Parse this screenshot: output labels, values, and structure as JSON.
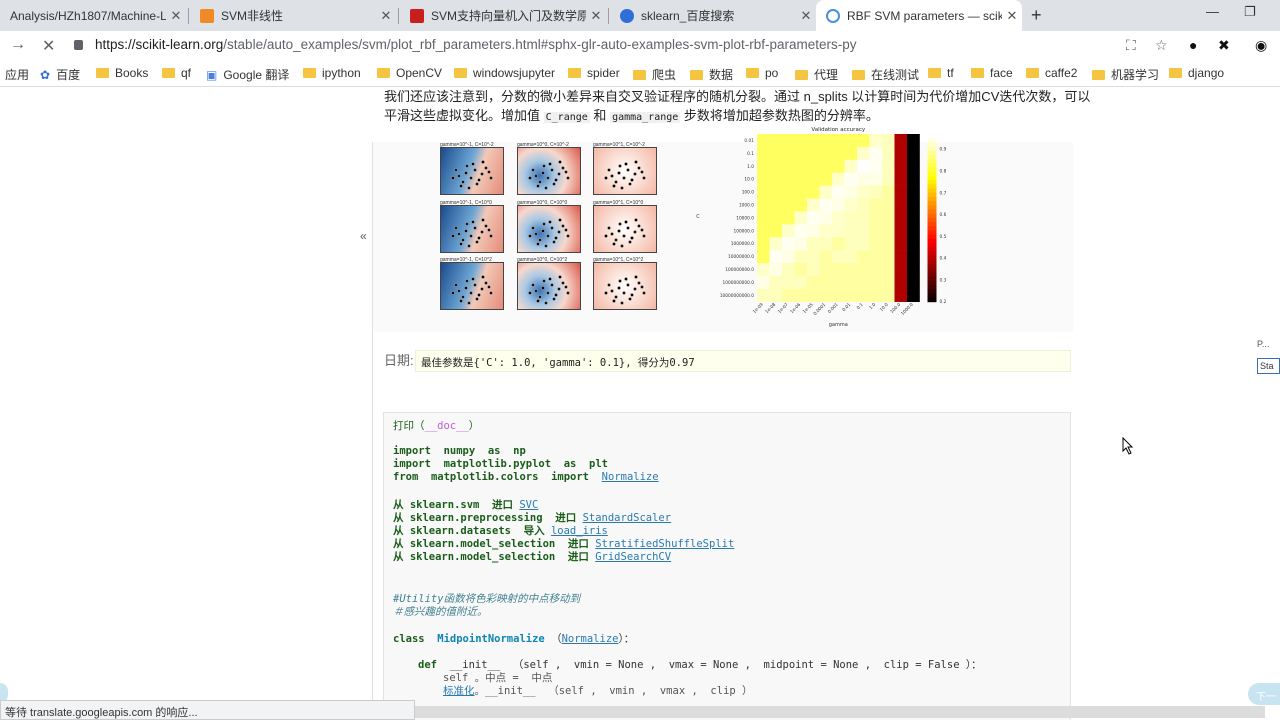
{
  "tabs": [
    {
      "title": "Analysis/HZh1807/Machine-Le",
      "favicon_color": "#24292e"
    },
    {
      "title": "SVM非线性",
      "favicon_color": "#f08a24"
    },
    {
      "title": "SVM支持向量机入门及数学原理",
      "favicon_color": "#c81e1e"
    },
    {
      "title": "sklearn_百度搜索",
      "favicon_color": "#2f6fd6"
    },
    {
      "title": "RBF SVM parameters — scikit-",
      "favicon_color": "#4a90d9"
    }
  ],
  "window_controls": {
    "minimize": "—",
    "restore": "❐"
  },
  "url": {
    "host": "https://scikit-learn.org",
    "path": "/stable/auto_examples/svm/plot_rbf_parameters.html#sphx-glr-auto-examples-svm-plot-rbf-parameters-py"
  },
  "bookmarks": {
    "apps": "应用",
    "items": [
      "百度",
      "Books",
      "qf",
      "Google 翻译",
      "ipython",
      "OpenCV",
      "windowsjupyter",
      "spider",
      "爬虫",
      "数据",
      "po",
      "代理",
      "在线测试",
      "tf",
      "face",
      "caffe2",
      "机器学习",
      "django"
    ]
  },
  "doc": {
    "para_line1": "我们还应该注意到，分数的微小差异来自交叉验证程序的随机分裂。通过 n_splits 以计算时间为代价增加CV迭代次数，可以",
    "para_line2_a": "平滑这些虚拟变化。增加值",
    "para_code1": "C_range",
    "para_line2_b": "和",
    "para_code2": "gamma_range",
    "para_line2_c": "步数将增加超参数热图的分辨率。",
    "collapse_icon": "«"
  },
  "figure": {
    "panel_titles": [
      "gamma=10^-1, C=10^-2",
      "gamma=10^0, C=10^-2",
      "gamma=10^1, C=10^-2",
      "gamma=10^-1, C=10^0",
      "gamma=10^0, C=10^0",
      "gamma=10^1, C=10^0",
      "gamma=10^-1, C=10^2",
      "gamma=10^0, C=10^2",
      "gamma=10^1, C=10^2"
    ]
  },
  "chart_data": {
    "type": "heatmap",
    "title": "Validation accuracy",
    "xlabel": "gamma",
    "ylabel": "C",
    "x_ticks": [
      "1e-09",
      "1e-08",
      "1e-07",
      "1e-06",
      "1e-05",
      "0.0001",
      "0.001",
      "0.01",
      "0.1",
      "1.0",
      "10.0",
      "100.0",
      "1000.0"
    ],
    "y_ticks": [
      "0.01",
      "0.1",
      "1.0",
      "10.0",
      "100.0",
      "1000.0",
      "10000.0",
      "100000.0",
      "1000000.0",
      "10000000.0",
      "100000000.0",
      "1000000000.0",
      "10000000000.0"
    ],
    "colorbar_ticks": [
      0.2,
      0.3,
      0.4,
      0.5,
      0.6,
      0.7,
      0.8,
      0.9
    ],
    "value_range": [
      0.2,
      0.97
    ],
    "values": [
      [
        0.85,
        0.85,
        0.85,
        0.85,
        0.85,
        0.85,
        0.85,
        0.85,
        0.85,
        0.93,
        0.92,
        0.4,
        0.2
      ],
      [
        0.85,
        0.85,
        0.85,
        0.85,
        0.85,
        0.85,
        0.85,
        0.85,
        0.93,
        0.96,
        0.92,
        0.4,
        0.2
      ],
      [
        0.85,
        0.85,
        0.85,
        0.85,
        0.85,
        0.85,
        0.85,
        0.93,
        0.97,
        0.96,
        0.92,
        0.4,
        0.2
      ],
      [
        0.85,
        0.85,
        0.85,
        0.85,
        0.85,
        0.85,
        0.93,
        0.96,
        0.95,
        0.95,
        0.92,
        0.4,
        0.2
      ],
      [
        0.85,
        0.85,
        0.85,
        0.85,
        0.85,
        0.93,
        0.96,
        0.95,
        0.93,
        0.92,
        0.9,
        0.4,
        0.2
      ],
      [
        0.85,
        0.85,
        0.85,
        0.85,
        0.93,
        0.96,
        0.95,
        0.93,
        0.92,
        0.9,
        0.9,
        0.4,
        0.2
      ],
      [
        0.85,
        0.85,
        0.85,
        0.93,
        0.96,
        0.95,
        0.93,
        0.92,
        0.92,
        0.9,
        0.9,
        0.4,
        0.2
      ],
      [
        0.85,
        0.85,
        0.93,
        0.96,
        0.95,
        0.93,
        0.93,
        0.92,
        0.92,
        0.9,
        0.9,
        0.4,
        0.2
      ],
      [
        0.85,
        0.93,
        0.96,
        0.95,
        0.92,
        0.92,
        0.9,
        0.92,
        0.92,
        0.9,
        0.9,
        0.4,
        0.2
      ],
      [
        0.85,
        0.96,
        0.95,
        0.92,
        0.92,
        0.9,
        0.92,
        0.92,
        0.9,
        0.9,
        0.9,
        0.4,
        0.2
      ],
      [
        0.93,
        0.95,
        0.92,
        0.9,
        0.92,
        0.9,
        0.9,
        0.9,
        0.9,
        0.9,
        0.9,
        0.4,
        0.2
      ],
      [
        0.95,
        0.92,
        0.92,
        0.92,
        0.9,
        0.9,
        0.9,
        0.9,
        0.9,
        0.9,
        0.9,
        0.4,
        0.2
      ],
      [
        0.92,
        0.92,
        0.9,
        0.9,
        0.9,
        0.9,
        0.9,
        0.9,
        0.9,
        0.9,
        0.9,
        0.4,
        0.2
      ]
    ]
  },
  "result": {
    "date_label": "日期:",
    "text": "最佳参数是{'C': 1.0, 'gamma': 0.1}, 得分为0.97"
  },
  "code": {
    "l1_a": "打印（",
    "l1_b": "__doc__",
    "l1_c": "）",
    "l3_kw": "import",
    "l3_mod": "numpy",
    "l3_as": "as",
    "l3_alias": "np",
    "l4_kw": "import",
    "l4_mod": "matplotlib.pyplot",
    "l4_as": "as",
    "l4_alias": "plt",
    "l5_kw": "from",
    "l5_mod": "matplotlib.colors",
    "l5_imp": "import",
    "l5_link": "Normalize",
    "l7": {
      "from": "从",
      "mod": "sklearn.svm",
      "imp": "进口",
      "link": "SVC"
    },
    "l8": {
      "from": "从",
      "mod": "sklearn.preprocessing",
      "imp": "进口",
      "link": "StandardScaler"
    },
    "l9": {
      "from": "从",
      "mod": "sklearn.datasets",
      "imp": "导入",
      "link": "load_iris"
    },
    "l10": {
      "from": "从",
      "mod": "sklearn.model_selection",
      "imp": "进口",
      "link": "StratifiedShuffleSplit"
    },
    "l11": {
      "from": "从",
      "mod": "sklearn.model_selection",
      "imp": "进口",
      "link": "GridSearchCV"
    },
    "c1": "#Utility函数将色彩映射的中点移动到",
    "c2": "＃感兴趣的值附近。",
    "cls_kw": "class",
    "cls_name": "MidpointNormalize",
    "cls_open": "（",
    "cls_link": "Normalize",
    "cls_close": "）：",
    "def_kw": "def",
    "def_sig": "__init__  （self ,  vmin = None ,  vmax = None ,  midpoint = None ,  clip = False ）：",
    "body1": "self 。中点 =  中点",
    "body2_link": "标准化",
    "body2_rest": "。__init__  （self ,  vmin ,  vmax ,  clip ）"
  },
  "status": "等待 translate.googleapis.com 的响应...",
  "right_float": {
    "p": "P...",
    "sta": "Sta",
    "next": "下一"
  }
}
